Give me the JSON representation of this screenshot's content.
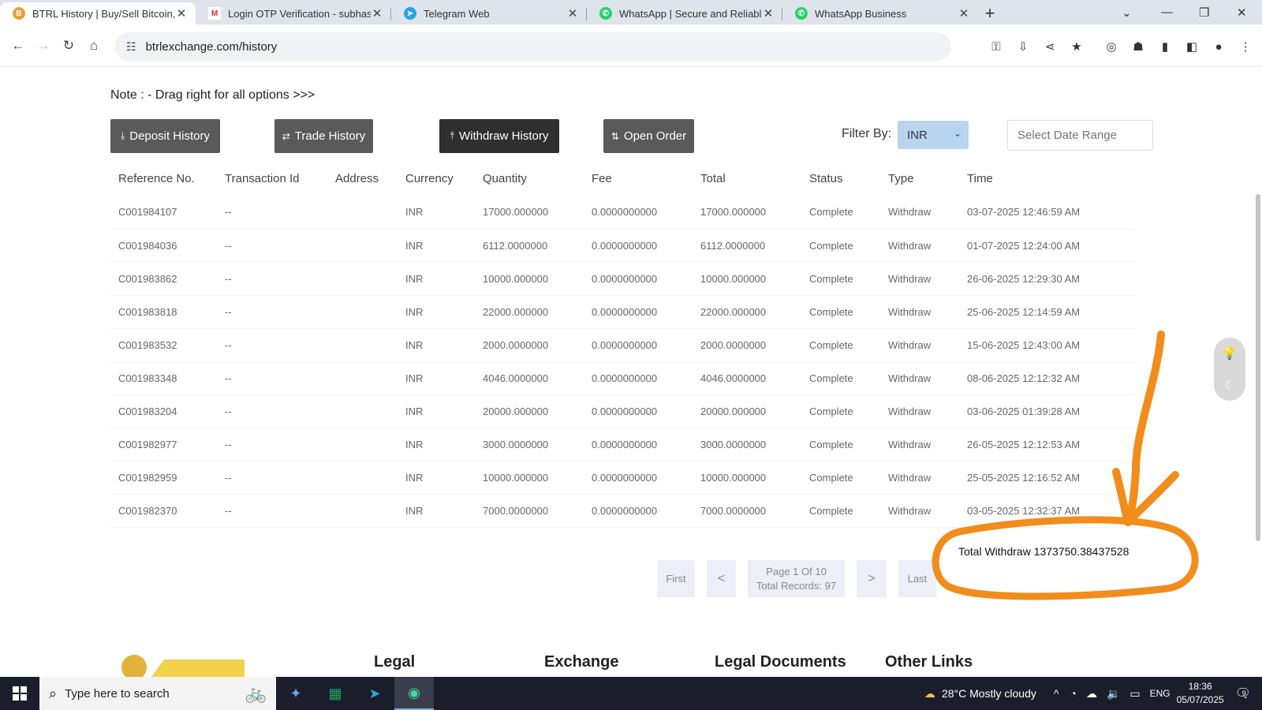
{
  "browser": {
    "tabs": [
      {
        "title": "BTRL History | Buy/Sell Bitcoin, C",
        "active": true,
        "icon": "btrl-coin-icon"
      },
      {
        "title": "Login OTP Verification - subhas",
        "active": false,
        "icon": "gmail-icon"
      },
      {
        "title": "Telegram Web",
        "active": false,
        "icon": "telegram-icon"
      },
      {
        "title": "WhatsApp | Secure and Reliable",
        "active": false,
        "icon": "whatsapp-icon"
      },
      {
        "title": "WhatsApp Business",
        "active": false,
        "icon": "whatsapp-icon"
      }
    ],
    "url": "btrlexchange.com/history"
  },
  "page": {
    "note": "Note : - Drag right for all options >>>",
    "buttons": {
      "deposit": "Deposit History",
      "trade": "Trade History",
      "withdraw": "Withdraw History",
      "open_order": "Open Order"
    },
    "filter": {
      "label": "Filter By:",
      "value": "INR"
    },
    "date_range_placeholder": "Select Date Range",
    "columns": [
      "Reference No.",
      "Transaction Id",
      "Address",
      "Currency",
      "Quantity",
      "Fee",
      "Total",
      "Status",
      "Type",
      "Time"
    ],
    "rows": [
      [
        "C001984107",
        "--",
        "",
        "INR",
        "17000.000000",
        "0.0000000000",
        "17000.000000",
        "Complete",
        "Withdraw",
        "03-07-2025 12:46:59 AM"
      ],
      [
        "C001984036",
        "--",
        "",
        "INR",
        "6112.0000000",
        "0.0000000000",
        "6112.0000000",
        "Complete",
        "Withdraw",
        "01-07-2025 12:24:00 AM"
      ],
      [
        "C001983862",
        "--",
        "",
        "INR",
        "10000.000000",
        "0.0000000000",
        "10000.000000",
        "Complete",
        "Withdraw",
        "26-06-2025 12:29:30 AM"
      ],
      [
        "C001983818",
        "--",
        "",
        "INR",
        "22000.000000",
        "0.0000000000",
        "22000.000000",
        "Complete",
        "Withdraw",
        "25-06-2025 12:14:59 AM"
      ],
      [
        "C001983532",
        "--",
        "",
        "INR",
        "2000.0000000",
        "0.0000000000",
        "2000.0000000",
        "Complete",
        "Withdraw",
        "15-06-2025 12:43:00 AM"
      ],
      [
        "C001983348",
        "--",
        "",
        "INR",
        "4046.0000000",
        "0.0000000000",
        "4046.0000000",
        "Complete",
        "Withdraw",
        "08-06-2025 12:12:32 AM"
      ],
      [
        "C001983204",
        "--",
        "",
        "INR",
        "20000.000000",
        "0.0000000000",
        "20000.000000",
        "Complete",
        "Withdraw",
        "03-06-2025 01:39:28 AM"
      ],
      [
        "C001982977",
        "--",
        "",
        "INR",
        "3000.0000000",
        "0.0000000000",
        "3000.0000000",
        "Complete",
        "Withdraw",
        "26-05-2025 12:12:53 AM"
      ],
      [
        "C001982959",
        "--",
        "",
        "INR",
        "10000.000000",
        "0.0000000000",
        "10000.000000",
        "Complete",
        "Withdraw",
        "25-05-2025 12:16:52 AM"
      ],
      [
        "C001982370",
        "--",
        "",
        "INR",
        "7000.0000000",
        "0.0000000000",
        "7000.0000000",
        "Complete",
        "Withdraw",
        "03-05-2025 12:32:37 AM"
      ]
    ],
    "pagination": {
      "first": "First",
      "prev": "<",
      "page_info": "Page 1 Of 10",
      "records": "Total Records: 97",
      "next": ">",
      "last": "Last"
    },
    "total_withdraw": "Total Withdraw 1373750.38437528",
    "annotation_color": "#f28c1b",
    "footer": {
      "headings": [
        "Legal",
        "Exchange",
        "Legal Documents",
        "Other Links"
      ]
    }
  },
  "taskbar": {
    "search_placeholder": "Type here to search",
    "weather": "28°C  Mostly cloudy",
    "language": "ENG",
    "time": "18:36",
    "date": "05/07/2025",
    "notifications": "9"
  }
}
